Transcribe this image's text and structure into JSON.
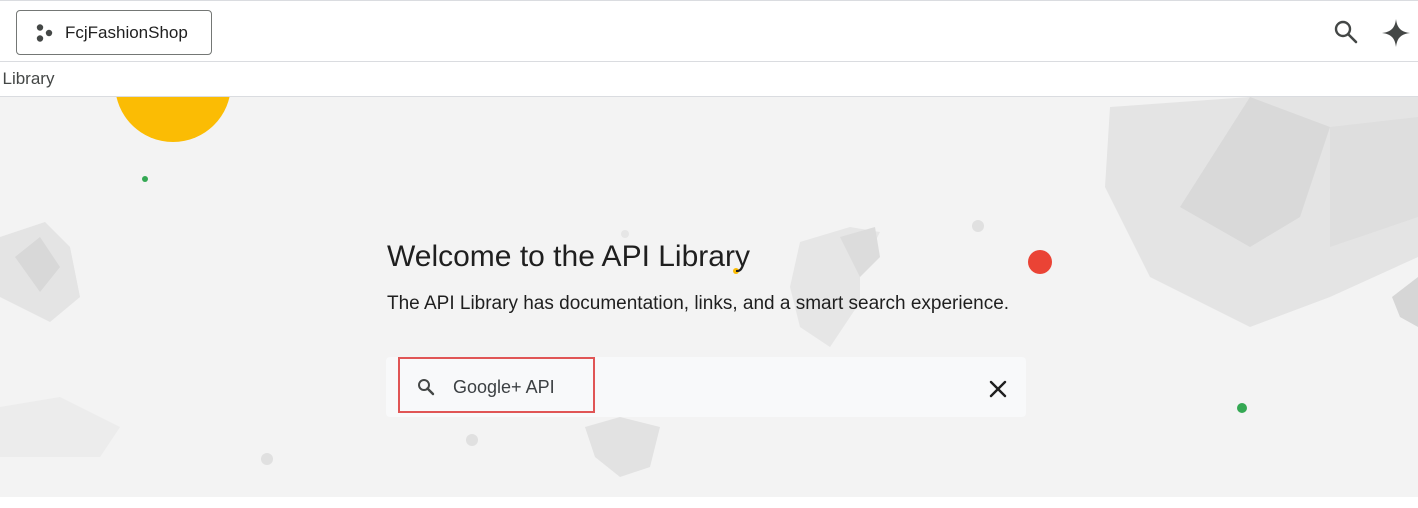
{
  "header": {
    "project_name": "FcjFashionShop",
    "project_icon": "project-nodes-icon",
    "search_icon": "search-icon",
    "assistant_icon": "sparkle-icon"
  },
  "breadcrumb": {
    "text": "l Library"
  },
  "hero": {
    "title": "Welcome to the API Library",
    "subtitle": "The API Library has documentation, links, and a smart search experience."
  },
  "search": {
    "value": "Google+ API",
    "placeholder": "",
    "search_icon": "search-icon",
    "clear_icon": "close-icon"
  },
  "colors": {
    "accent_red": "#ea4335",
    "accent_yellow": "#fbbc04",
    "accent_green": "#34a853",
    "highlight": "#e05555"
  }
}
